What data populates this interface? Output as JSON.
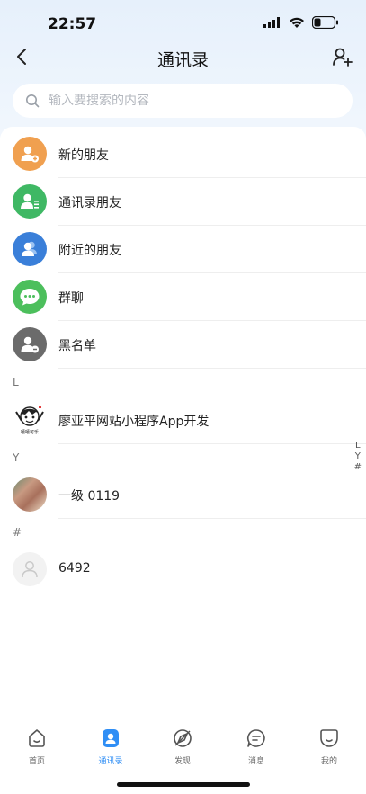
{
  "status": {
    "time": "22:57"
  },
  "nav": {
    "title": "通讯录"
  },
  "search": {
    "placeholder": "输入要搜索的内容"
  },
  "functions": [
    {
      "label": "新的朋友",
      "icon": "new-friend-icon",
      "color": "#f0a050"
    },
    {
      "label": "通讯录朋友",
      "icon": "contacts-friend-icon",
      "color": "#3fb864"
    },
    {
      "label": "附近的朋友",
      "icon": "nearby-friend-icon",
      "color": "#3a7fd9"
    },
    {
      "label": "群聊",
      "icon": "group-chat-icon",
      "color": "#4cbf5c"
    },
    {
      "label": "黑名单",
      "icon": "blacklist-icon",
      "color": "#6b6b6b"
    }
  ],
  "sections": [
    {
      "letter": "L",
      "contacts": [
        {
          "name": "廖亚平网站小程序App开发",
          "avatar": "cartoon-avatar",
          "avatar_caption": "嘻嘻可乐"
        }
      ]
    },
    {
      "letter": "Y",
      "contacts": [
        {
          "name": "一级 0119",
          "avatar": "photo-avatar"
        }
      ]
    },
    {
      "letter": "#",
      "contacts": [
        {
          "name": "6492",
          "avatar": "default-avatar"
        }
      ]
    }
  ],
  "index": [
    "L",
    "Y",
    "#"
  ],
  "tabs": [
    {
      "label": "首页",
      "icon": "home-icon",
      "active": false
    },
    {
      "label": "通讯录",
      "icon": "contacts-tab-icon",
      "active": true
    },
    {
      "label": "发现",
      "icon": "discover-icon",
      "active": false
    },
    {
      "label": "消息",
      "icon": "message-icon",
      "active": false
    },
    {
      "label": "我的",
      "icon": "profile-icon",
      "active": false
    }
  ],
  "colors": {
    "accent": "#2f8ef5",
    "background_top": "#e6f0fb"
  }
}
